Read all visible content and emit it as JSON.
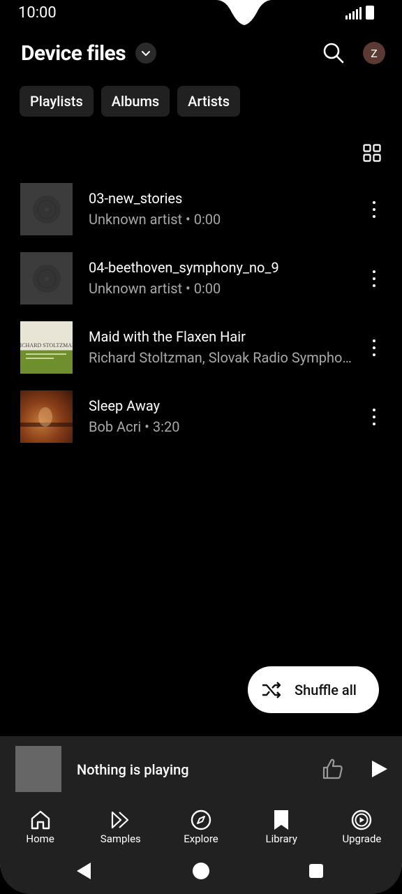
{
  "status_bar": {
    "time": "10:00"
  },
  "header": {
    "title": "Device files",
    "avatar_initial": "Z"
  },
  "chips": [
    {
      "label": "Playlists"
    },
    {
      "label": "Albums"
    },
    {
      "label": "Artists"
    }
  ],
  "tracks": [
    {
      "title": "03-new_stories",
      "subtitle": "Unknown artist • 0:00",
      "art": "placeholder-disc"
    },
    {
      "title": "04-beethoven_symphony_no_9",
      "subtitle": "Unknown artist • 0:00",
      "art": "placeholder-disc"
    },
    {
      "title": "Maid with the Flaxen Hair",
      "subtitle": "Richard Stoltzman, Slovak Radio Symphony Orchestra",
      "art": "album-cover-richard-stoltzman",
      "art_text": "RICHARD STOLTZMAN"
    },
    {
      "title": "Sleep Away",
      "subtitle": "Bob Acri • 3:20",
      "art": "album-cover-bob-acri"
    }
  ],
  "shuffle": {
    "label": "Shuffle all"
  },
  "miniplayer": {
    "title": "Nothing is playing"
  },
  "bottom_nav": [
    {
      "label": "Home",
      "icon": "home-icon"
    },
    {
      "label": "Samples",
      "icon": "samples-icon"
    },
    {
      "label": "Explore",
      "icon": "explore-icon"
    },
    {
      "label": "Library",
      "icon": "library-icon"
    },
    {
      "label": "Upgrade",
      "icon": "upgrade-icon"
    }
  ],
  "colors": {
    "background": "#000000",
    "surface": "#212121",
    "chip": "#212121",
    "subtitle": "#a8a8a8",
    "avatar": "#5a3a32"
  }
}
